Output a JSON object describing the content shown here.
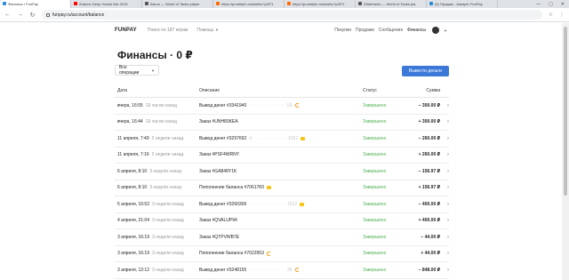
{
  "browser": {
    "tabs": [
      {
        "label": "Финансы / FunPay",
        "color": "#2a8bd6",
        "active": true
      },
      {
        "label": "Autumn Deep House Mix 2019",
        "color": "#ff0000"
      },
      {
        "label": "Ikarus — World of Tanks player",
        "color": "#555555"
      },
      {
        "label": "https://prostripin.ru/stat/eu?p/571",
        "color": "#ff6a00"
      },
      {
        "label": "https://prostripin.ru/stat/eu?p/571",
        "color": "#ff6a00"
      },
      {
        "label": "Gilderheim — World of Tanks pla",
        "color": "#555555"
      },
      {
        "label": "(5) Продаю - Аккаунт FunPay",
        "color": "#2a8bd6"
      }
    ],
    "url": "funpay.ru/account/balance"
  },
  "header": {
    "logo": "FUNPAY",
    "search": "Поиск по 187 играм",
    "help": "Помощь",
    "nav": [
      "Покупки",
      "Продажи",
      "Сообщения",
      "Финансы"
    ]
  },
  "page": {
    "title": "Финансы · 0 ₽",
    "filter": "Все операции",
    "withdraw": "Вывести деньги"
  },
  "table": {
    "headers": {
      "date": "Дата",
      "desc": "Описание",
      "status": "Статус",
      "sum": "Сумма"
    },
    "rows": [
      {
        "date": "вчера, 16:55",
        "ago": "19 часов назад",
        "desc": "Вывод денег #3341940",
        "masked": "· · · · · · · · · · · · · · 50",
        "icon": "orange",
        "status": "Завершено",
        "sum": "− 300.00 ₽"
      },
      {
        "date": "вчера, 16:44",
        "ago": "19 часов назад",
        "desc": "Заказ #UNH83KEA",
        "masked": "",
        "icon": "",
        "status": "Завершено",
        "sum": "+ 300.00 ₽"
      },
      {
        "date": "11 апреля, 7:49",
        "ago": "2 недели назад",
        "desc": "Вывод денег #3297692",
        "masked": "4 · · · · · · · · · · · · · 1562",
        "icon": "lock",
        "status": "Завершено",
        "sum": "− 260.00 ₽"
      },
      {
        "date": "11 апреля, 7:16",
        "ago": "2 недели назад",
        "desc": "Заказ #PSF4WRNY",
        "masked": "",
        "icon": "",
        "status": "Завершено",
        "sum": "+ 260.00 ₽"
      },
      {
        "date": "6 апреля, 8:10",
        "ago": "3 недели назад",
        "desc": "Заказ #GA848Y1K",
        "masked": "",
        "icon": "",
        "status": "Завершено",
        "sum": "− 156.97 ₽"
      },
      {
        "date": "6 апреля, 8:10",
        "ago": "3 недели назад",
        "desc": "Пополнение баланса #7061783",
        "masked": "",
        "icon": "lock",
        "status": "Завершено",
        "sum": "+ 156.97 ₽"
      },
      {
        "date": "5 апреля, 10:52",
        "ago": "3 недели назад",
        "desc": "Вывод денег #3260306",
        "masked": "· · · · · · · · · · · · · · 1562",
        "icon": "lock",
        "status": "Завершено",
        "sum": "− 400.00 ₽"
      },
      {
        "date": "4 апреля, 21:04",
        "ago": "3 недели назад",
        "desc": "Заказ #QVALUP94",
        "masked": "",
        "icon": "",
        "status": "Завершено",
        "sum": "+ 400.00 ₽"
      },
      {
        "date": "3 апреля, 16:19",
        "ago": "3 недели назад",
        "desc": "Заказ #QTPVWB7E",
        "masked": "",
        "icon": "",
        "status": "Завершено",
        "sum": "− 44.00 ₽"
      },
      {
        "date": "3 апреля, 16:19",
        "ago": "3 недели назад",
        "desc": "Пополнение баланса #7022953",
        "masked": "",
        "icon": "orange",
        "status": "Завершено",
        "sum": "+ 44.00 ₽"
      },
      {
        "date": "3 апреля, 12:12",
        "ago": "3 недели назад",
        "desc": "Вывод денег #3248155",
        "masked": "· · · · · · · · · · · · · · 36",
        "icon": "orange",
        "status": "Завершено",
        "sum": "− 848.00 ₽"
      }
    ]
  }
}
